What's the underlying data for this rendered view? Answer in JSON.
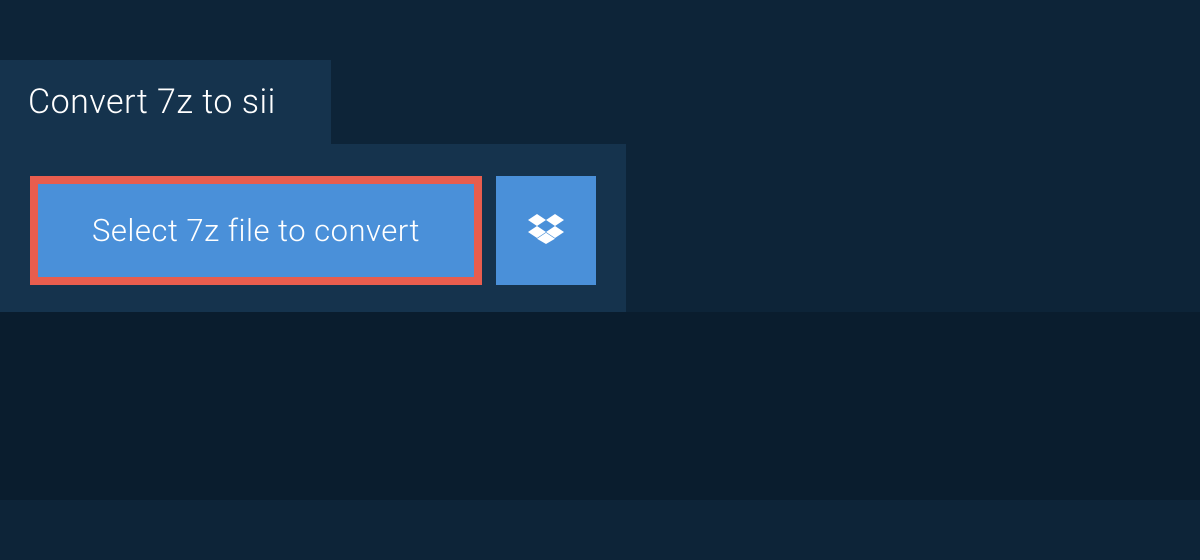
{
  "tab": {
    "title": "Convert 7z to sii"
  },
  "actions": {
    "select_file_label": "Select 7z file to convert"
  }
}
